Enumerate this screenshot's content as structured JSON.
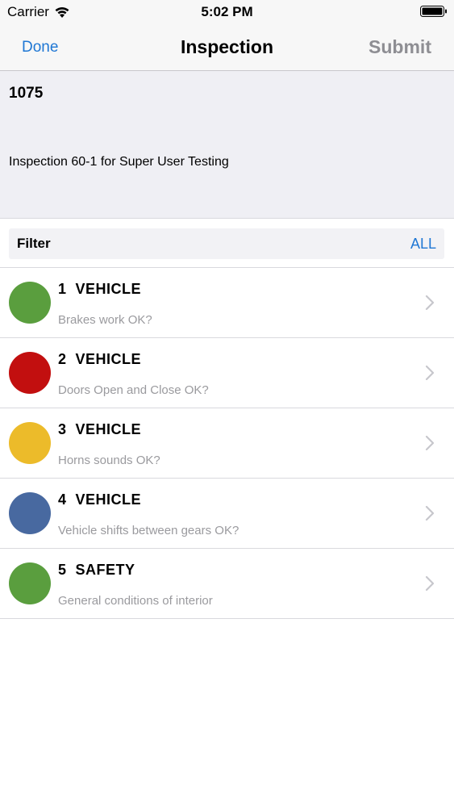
{
  "status_bar": {
    "carrier": "Carrier",
    "time": "5:02 PM"
  },
  "nav": {
    "done_label": "Done",
    "title": "Inspection",
    "submit_label": "Submit"
  },
  "info": {
    "number": "1075",
    "description": "Inspection 60-1 for Super User Testing"
  },
  "filter": {
    "label": "Filter",
    "value": "ALL"
  },
  "items": [
    {
      "title": "1  VEHICLE",
      "subtitle": "Brakes work OK?",
      "status_color": "#5a9e3e"
    },
    {
      "title": "2  VEHICLE",
      "subtitle": "Doors Open and Close OK?",
      "status_color": "#c20f0f"
    },
    {
      "title": "3  VEHICLE",
      "subtitle": "Horns sounds OK?",
      "status_color": "#ecbb2a"
    },
    {
      "title": "4  VEHICLE",
      "subtitle": "Vehicle shifts between gears OK?",
      "status_color": "#4869a0"
    },
    {
      "title": "5  SAFETY",
      "subtitle": "General conditions of interior",
      "status_color": "#5a9e3e"
    }
  ],
  "icons": {
    "wifi": "wifi-icon",
    "battery": "battery-icon",
    "chevron": "chevron-right-icon"
  }
}
